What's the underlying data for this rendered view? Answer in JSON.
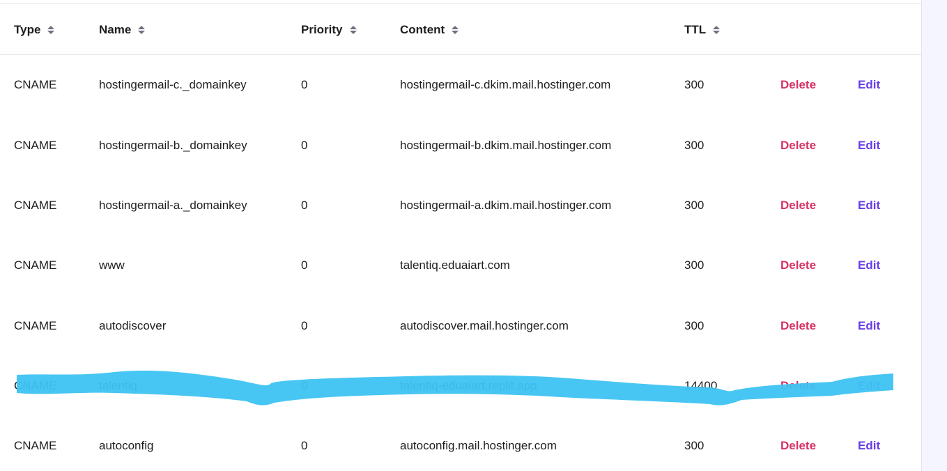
{
  "table": {
    "columns": [
      {
        "key": "type",
        "label": "Type"
      },
      {
        "key": "name",
        "label": "Name"
      },
      {
        "key": "priority",
        "label": "Priority"
      },
      {
        "key": "content",
        "label": "Content"
      },
      {
        "key": "ttl",
        "label": "TTL"
      }
    ],
    "rows": [
      {
        "type": "CNAME",
        "name": "hostingermail-c._domainkey",
        "priority": "0",
        "content": "hostingermail-c.dkim.mail.hostinger.com",
        "ttl": "300",
        "delete_label": "Delete",
        "edit_label": "Edit"
      },
      {
        "type": "CNAME",
        "name": "hostingermail-b._domainkey",
        "priority": "0",
        "content": "hostingermail-b.dkim.mail.hostinger.com",
        "ttl": "300",
        "delete_label": "Delete",
        "edit_label": "Edit"
      },
      {
        "type": "CNAME",
        "name": "hostingermail-a._domainkey",
        "priority": "0",
        "content": "hostingermail-a.dkim.mail.hostinger.com",
        "ttl": "300",
        "delete_label": "Delete",
        "edit_label": "Edit"
      },
      {
        "type": "CNAME",
        "name": "www",
        "priority": "0",
        "content": "talentiq.eduaiart.com",
        "ttl": "300",
        "delete_label": "Delete",
        "edit_label": "Edit"
      },
      {
        "type": "CNAME",
        "name": "autodiscover",
        "priority": "0",
        "content": "autodiscover.mail.hostinger.com",
        "ttl": "300",
        "delete_label": "Delete",
        "edit_label": "Edit"
      },
      {
        "type": "CNAME",
        "name": "talentiq",
        "priority": "0",
        "content": "talentiq-eduaiart.replit.app",
        "ttl": "14400",
        "delete_label": "Delete",
        "edit_label": "Edit"
      },
      {
        "type": "CNAME",
        "name": "autoconfig",
        "priority": "0",
        "content": "autoconfig.mail.hostinger.com",
        "ttl": "300",
        "delete_label": "Delete",
        "edit_label": "Edit"
      }
    ]
  },
  "colors": {
    "delete": "#d63163",
    "edit": "#673de6",
    "highlight_marker": "#3ec3f2",
    "text": "#1d1e20",
    "border": "#e3e3ea"
  },
  "icons": {
    "sort": "sort-icon"
  },
  "highlighted_row": 5
}
